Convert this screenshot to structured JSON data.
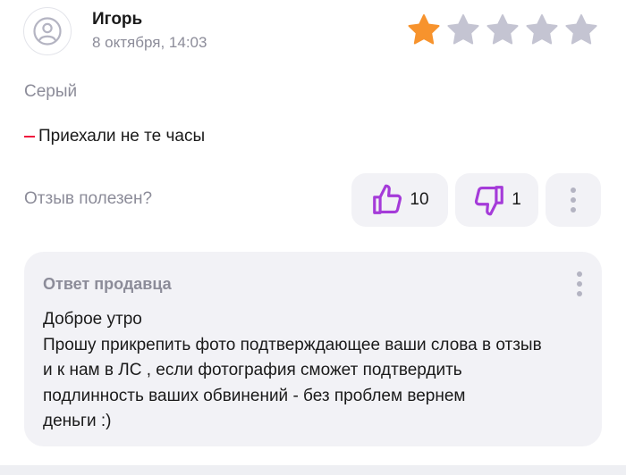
{
  "review": {
    "author": "Игорь",
    "date": "8 октября, 14:03",
    "rating": 1,
    "max_rating": 5,
    "variant": "Серый",
    "con": "Приехали не те часы",
    "helpful_question": "Отзыв полезен?",
    "likes": "10",
    "dislikes": "1"
  },
  "seller_reply": {
    "title": "Ответ продавца",
    "text": "Доброе утро\nПрошу прикрепить фото подтверждающее ваши слова в отзыв\nи к нам в ЛС , если фотография сможет подтвердить\nподлинность ваших обвинений - без проблем  вернем\nденьги :)"
  },
  "colors": {
    "star_filled": "#f7932d",
    "star_empty": "#c4c4d2",
    "accent_purple": "#a53bd9",
    "con_marker": "#f0173d",
    "muted_text": "#8c8c99",
    "button_bg": "#f2f2f6"
  },
  "icons": {
    "avatar": "user-avatar-icon",
    "like": "thumbs-up-icon",
    "dislike": "thumbs-down-icon",
    "more": "vertical-dots-icon",
    "star": "star-icon"
  }
}
